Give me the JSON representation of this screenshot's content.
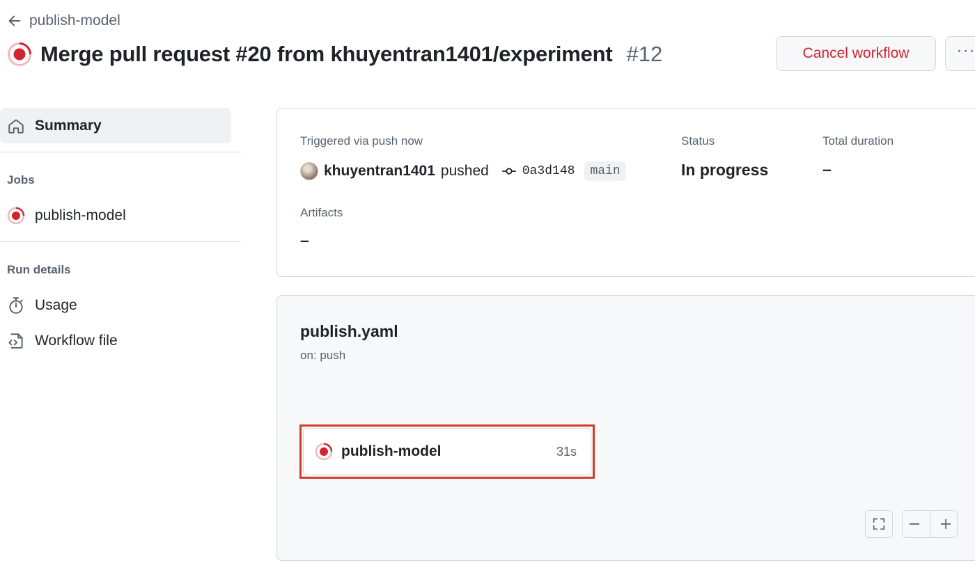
{
  "header": {
    "back_label": "publish-model",
    "title": "Merge pull request #20 from khuyentran1401/experiment",
    "run_number": "#12",
    "cancel_label": "Cancel workflow",
    "more_label": "···"
  },
  "sidebar": {
    "summary_label": "Summary",
    "jobs_heading": "Jobs",
    "jobs": [
      {
        "label": "publish-model"
      }
    ],
    "run_details_heading": "Run details",
    "run_details": [
      {
        "label": "Usage",
        "icon": "stopwatch-icon"
      },
      {
        "label": "Workflow file",
        "icon": "file-code-icon"
      }
    ]
  },
  "summary": {
    "trigger_label": "Triggered via push now",
    "actor": "khuyentran1401",
    "action": "pushed",
    "commit_sha": "0a3d148",
    "branch": "main",
    "status_label": "Status",
    "status_value": "In progress",
    "duration_label": "Total duration",
    "duration_value": "–",
    "artifacts_label": "Artifacts",
    "artifacts_value": "–"
  },
  "workflow": {
    "file_name": "publish.yaml",
    "trigger": "on: push",
    "job": {
      "name": "publish-model",
      "duration": "31s"
    }
  },
  "colors": {
    "in_progress": "#d1242f",
    "highlight": "#d33b2b",
    "muted_text": "#59636e",
    "border": "#d1d9e0"
  }
}
